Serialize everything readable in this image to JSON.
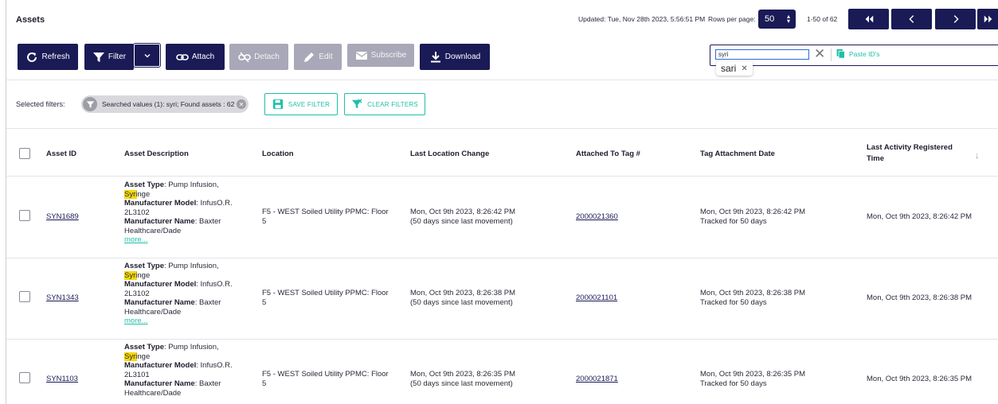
{
  "header": {
    "title": "Assets",
    "updated": "Updated: Tue, Nov 28th 2023, 5:56:51 PM",
    "rows_per_page_label": "Rows per page:",
    "rows_per_page_value": "50",
    "range": "1-50 of 62"
  },
  "toolbar": {
    "refresh": "Refresh",
    "filter": "Filter",
    "attach": "Attach",
    "detach": "Detach",
    "edit": "Edit",
    "subscribe": "Subscribe",
    "download": "Download"
  },
  "search": {
    "value": "syri",
    "paste_ids": "Paste ID's",
    "token": "sari"
  },
  "filters": {
    "label": "Selected filters:",
    "chip": "Searched values (1): syri; Found assets : 62",
    "save": "SAVE FILTER",
    "clear": "CLEAR FILTERS"
  },
  "table": {
    "columns": {
      "asset_id": "Asset ID",
      "description": "Asset Description",
      "location": "Location",
      "last_location_change": "Last Location Change",
      "attached_to_tag": "Attached To Tag #",
      "tag_attachment_date": "Tag Attachment Date",
      "last_activity": "Last Activity Registered Time"
    },
    "desc_labels": {
      "type": "Asset Type",
      "model": "Manufacturer Model",
      "name": "Manufacturer Name",
      "more": "more..."
    },
    "rows": [
      {
        "id": "SYN1689",
        "type_pre": ": Pump Infusion,",
        "type_hl": "Syri",
        "type_post": "nge",
        "model": ": InfusO.R. 2L3102",
        "mname": ": Baxter Healthcare/Dade",
        "location": "F5 - WEST Soiled Utility PPMC: Floor 5",
        "loc_change": "Mon, Oct 9th 2023, 8:26:42 PM",
        "loc_since": "(50 days since last movement)",
        "tag": "2000021360",
        "tag_date": "Mon, Oct 9th 2023, 8:26:42 PM",
        "tracked": "Tracked for 50 days",
        "last_activity": "Mon, Oct 9th 2023, 8:26:42 PM"
      },
      {
        "id": "SYN1343",
        "type_pre": ": Pump Infusion,",
        "type_hl": "Syri",
        "type_post": "nge",
        "model": ": InfusO.R. 2L3102",
        "mname": ": Baxter Healthcare/Dade",
        "location": "F5 - WEST Soiled Utility PPMC: Floor 5",
        "loc_change": "Mon, Oct 9th 2023, 8:26:38 PM",
        "loc_since": "(50 days since last movement)",
        "tag": "2000021101",
        "tag_date": "Mon, Oct 9th 2023, 8:26:38 PM",
        "tracked": "Tracked for 50 days",
        "last_activity": "Mon, Oct 9th 2023, 8:26:38 PM"
      },
      {
        "id": "SYN1103",
        "type_pre": ": Pump Infusion,",
        "type_hl": "Syri",
        "type_post": "nge",
        "model": ": InfusO.R. 2L3101",
        "mname": ": Baxter Healthcare/Dade",
        "location": "F5 - WEST Soiled Utility PPMC: Floor 5",
        "loc_change": "Mon, Oct 9th 2023, 8:26:35 PM",
        "loc_since": "(50 days since last movement)",
        "tag": "2000021871",
        "tag_date": "Mon, Oct 9th 2023, 8:26:35 PM",
        "tracked": "Tracked for 50 days",
        "last_activity": "Mon, Oct 9th 2023, 8:26:35 PM"
      }
    ]
  },
  "colors": {
    "primary": "#1a1a56",
    "disabled": "#a8a8b8",
    "accent": "#1fbfa8",
    "highlight": "#f5d90a"
  }
}
